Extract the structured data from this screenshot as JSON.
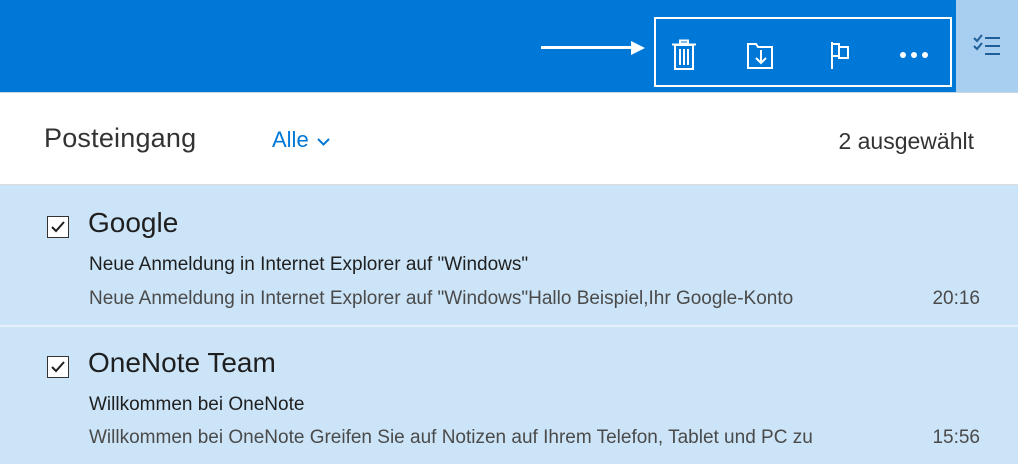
{
  "toolbar": {
    "actions": [
      {
        "name": "delete",
        "icon": "trash-icon"
      },
      {
        "name": "move",
        "icon": "move-to-folder-icon"
      },
      {
        "name": "flag",
        "icon": "flag-icon"
      },
      {
        "name": "more",
        "icon": "more-dots-icon"
      }
    ],
    "select_mode_icon": "select-list-icon",
    "accent_color": "#0078d7"
  },
  "header": {
    "folder_title": "Posteingang",
    "filter_label": "Alle",
    "selected_count": "2 ausgewählt"
  },
  "messages": [
    {
      "checked": true,
      "sender": "Google",
      "subject": "Neue Anmeldung in Internet Explorer auf \"Windows\"",
      "preview": "Neue Anmeldung in Internet Explorer auf \"Windows\"Hallo Beispiel,Ihr Google-Konto",
      "time": "20:16"
    },
    {
      "checked": true,
      "sender": "OneNote Team",
      "subject": "Willkommen bei OneNote",
      "preview": "Willkommen bei OneNote Greifen Sie auf Notizen auf Ihrem Telefon, Tablet und PC zu",
      "time": "15:56"
    }
  ],
  "colors": {
    "selected_row_bg": "#cce4f7",
    "select_mode_bg": "#a9cff0"
  }
}
